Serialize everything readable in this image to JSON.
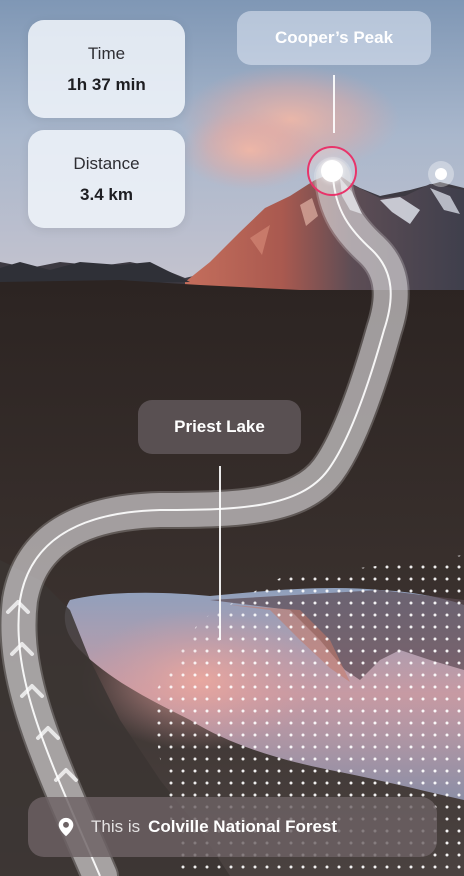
{
  "stats": {
    "time_label": "Time",
    "time_value": "1h 37 min",
    "distance_label": "Distance",
    "distance_value": "3.4 km"
  },
  "peak": {
    "name": "Cooper’s Peak"
  },
  "lake": {
    "name": "Priest Lake"
  },
  "location": {
    "prefix": "This is",
    "name": "Colville National Forest",
    "icon": "location-pin-icon"
  },
  "colors": {
    "peak_marker_ring": "#e8346a",
    "card_background": "#f0f4fa",
    "label_dark": "#5c5456"
  }
}
